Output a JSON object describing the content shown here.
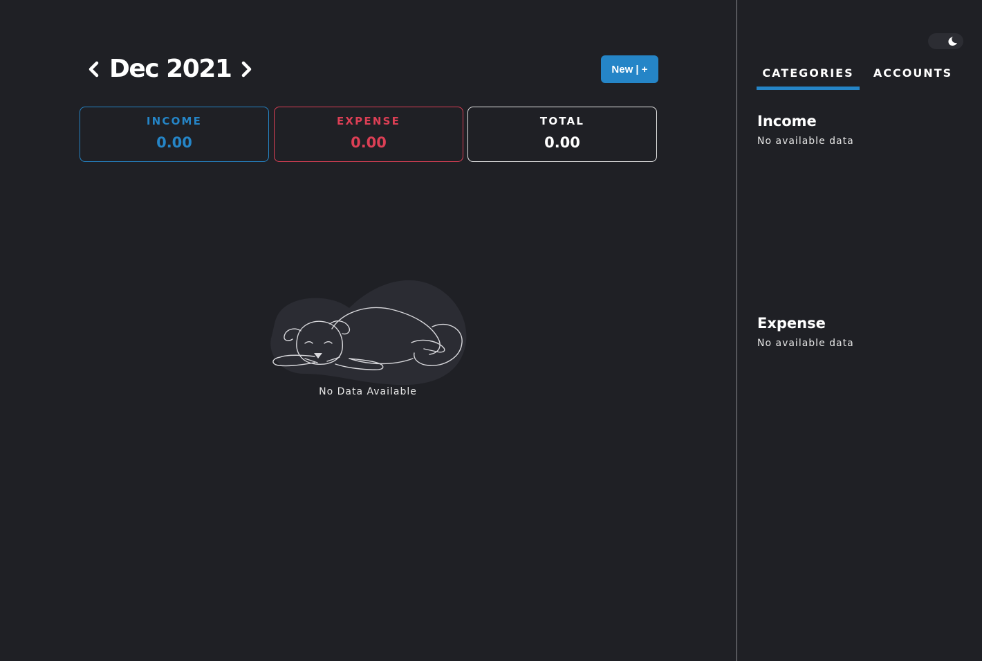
{
  "header": {
    "month": "Dec 2021",
    "new_button_label": "New | +"
  },
  "summary": {
    "income": {
      "label": "INCOME",
      "value": "0.00",
      "color": "#2585c7"
    },
    "expense": {
      "label": "EXPENSE",
      "value": "0.00",
      "color": "#dc3f55"
    },
    "total": {
      "label": "TOTAL",
      "value": "0.00",
      "color": "#ffffff"
    }
  },
  "empty_state": {
    "message": "No Data Available",
    "icon": "sleeping-dog-illustration"
  },
  "panel": {
    "theme": "dark",
    "tabs": [
      {
        "label": "CATEGORIES",
        "active": true
      },
      {
        "label": "ACCOUNTS",
        "active": false
      }
    ],
    "sections": [
      {
        "title": "Income",
        "empty_text": "No available data"
      },
      {
        "title": "Expense",
        "empty_text": "No available data"
      }
    ]
  },
  "colors": {
    "background": "#1f2025",
    "accent": "#2585c7",
    "danger": "#dc3f55"
  }
}
